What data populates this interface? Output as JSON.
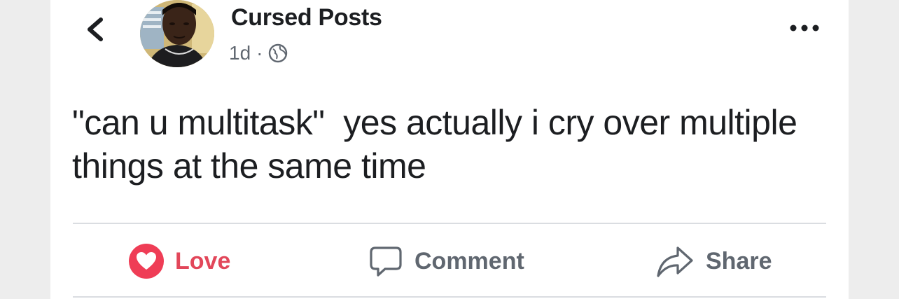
{
  "post": {
    "author": "Cursed Posts",
    "time": "1d",
    "separator": "·",
    "privacy_icon": "globe-icon",
    "text_quote": "\"can u multitask\"",
    "text_rest": "  yes actually i cry over multiple things at the same time"
  },
  "actions": {
    "love_label": "Love",
    "comment_label": "Comment",
    "share_label": "Share"
  },
  "colors": {
    "love": "#e2475a",
    "secondary_text": "#606770",
    "primary_text": "#1c1e21"
  }
}
